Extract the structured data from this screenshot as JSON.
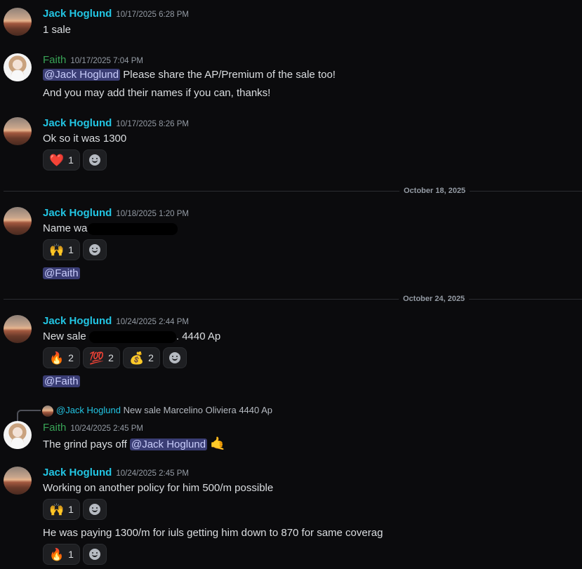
{
  "users": {
    "jack": "Jack Hoglund",
    "faith": "Faith"
  },
  "messages": [
    {
      "id": 1,
      "author": "Jack Hoglund",
      "timestamp": "10/17/2025 6:28 PM",
      "lines": [
        "1 sale"
      ]
    },
    {
      "id": 2,
      "author": "Faith",
      "timestamp": "10/17/2025 7:04 PM",
      "mention": "@Jack Hoglund",
      "text1": " Please share the AP/Premium of the sale too!",
      "text2": "And you may add their names if you can, thanks!"
    },
    {
      "id": 3,
      "author": "Jack Hoglund",
      "timestamp": "10/17/2025 8:26 PM",
      "lines": [
        "Ok so it was 1300"
      ],
      "reactions": [
        {
          "emoji": "heart-emoji",
          "glyph": "❤️",
          "count": "1"
        }
      ]
    },
    {
      "id": 4,
      "author": "Jack Hoglund",
      "timestamp": "10/18/2025 1:20 PM",
      "text": "Name wa",
      "reactions": [
        {
          "emoji": "raised-hands-emoji",
          "glyph": "🙌",
          "count": "1"
        }
      ],
      "mention": "@Faith"
    },
    {
      "id": 5,
      "author": "Jack Hoglund",
      "timestamp": "10/24/2025 2:44 PM",
      "text_end": ". 4440 Ap",
      "text_start": "New sale",
      "reactions": [
        {
          "emoji": "fire-emoji",
          "glyph": "🔥",
          "count": "2"
        },
        {
          "emoji": "hundred-emoji",
          "glyph": "💯",
          "count": "2"
        },
        {
          "emoji": "money-bag-emoji",
          "glyph": "💰",
          "count": "2"
        }
      ],
      "mention": "@Faith"
    },
    {
      "id": 6,
      "author": "Faith",
      "timestamp": "10/24/2025 2:45 PM",
      "reply": {
        "name": "@Jack Hoglund",
        "text": "New sale Marcelino Oliviera 4440 Ap"
      },
      "text": "The grind pays off ",
      "mention": "@Jack Hoglund",
      "emoji_glyph": "🤙"
    },
    {
      "id": 7,
      "author": "Jack Hoglund",
      "timestamp": "10/24/2025 2:45 PM",
      "line1": "Working on another policy for him 500/m possible",
      "reactions1": [
        {
          "emoji": "raised-hands-emoji",
          "glyph": "🙌",
          "count": "1"
        }
      ],
      "line2": "He was paying 1300/m for iuls getting him down to 870 for same coverag",
      "reactions2": [
        {
          "emoji": "fire-emoji",
          "glyph": "🔥",
          "count": "1"
        }
      ]
    }
  ],
  "dividers": [
    "October 18, 2025",
    "October 24, 2025"
  ]
}
